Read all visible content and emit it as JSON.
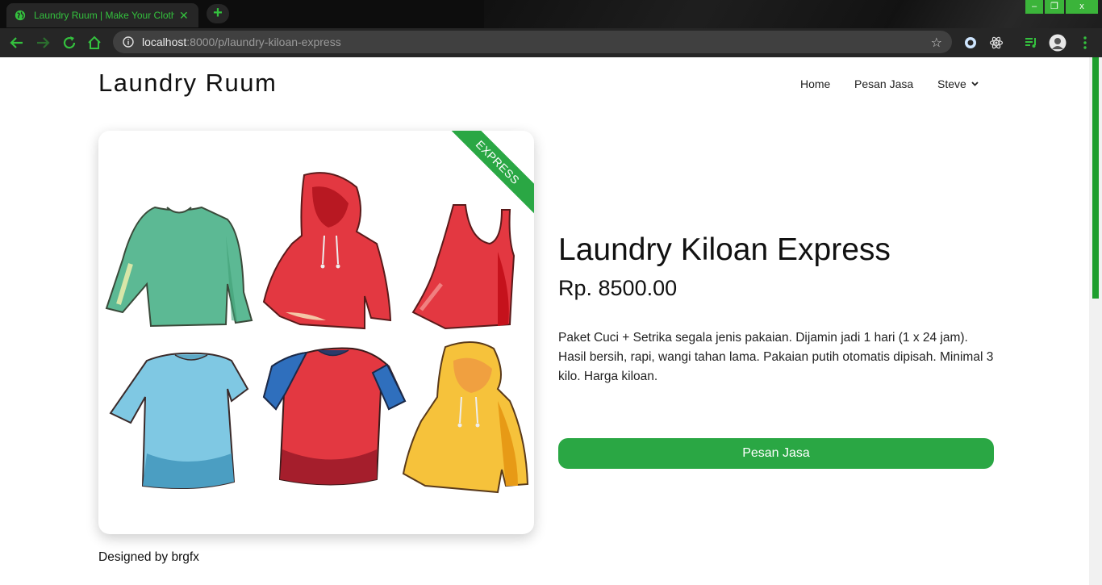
{
  "browser": {
    "tab_title": "Laundry Ruum | Make Your Cloth",
    "tab_close": "✕",
    "new_tab": "+",
    "url_host": "localhost",
    "url_path": ":8000/p/laundry-kiloan-express",
    "window_controls": {
      "minimize": "–",
      "restore": "❐",
      "close": "x"
    },
    "accent_color": "#34c13e"
  },
  "header": {
    "brand": "Laundry Ruum",
    "nav": {
      "home": "Home",
      "order": "Pesan Jasa",
      "user": "Steve"
    }
  },
  "product": {
    "badge": "EXPRESS",
    "title": "Laundry Kiloan Express",
    "price": "Rp. 8500.00",
    "description": "Paket Cuci + Setrika segala jenis pakaian. Dijamin jadi 1 hari (1 x 24 jam). Hasil bersih, rapi, wangi tahan lama. Pakaian putih otomatis dipisah. Minimal 3 kilo. Harga kiloan.",
    "order_button": "Pesan Jasa",
    "accent_color": "#2aa744"
  },
  "footer": {
    "credit": "Designed by brgfx"
  }
}
